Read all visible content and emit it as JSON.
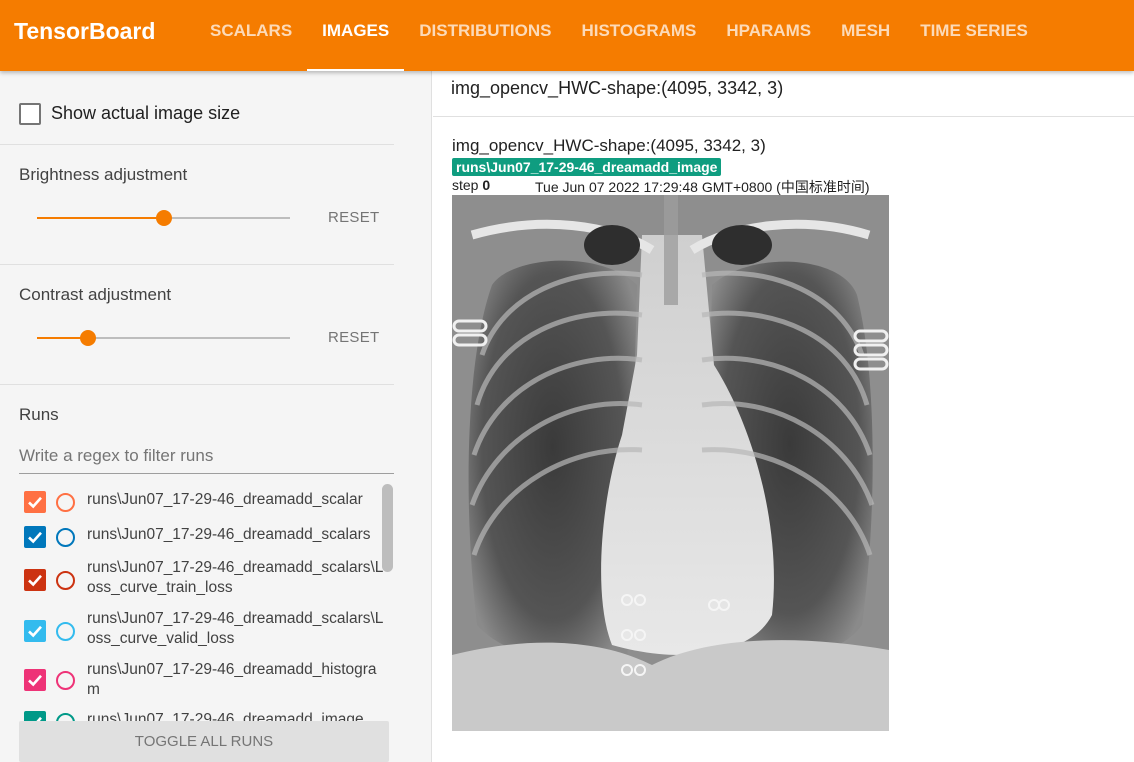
{
  "app": {
    "title": "TensorBoard"
  },
  "tabs": [
    {
      "label": "SCALARS",
      "active": false
    },
    {
      "label": "IMAGES",
      "active": true
    },
    {
      "label": "DISTRIBUTIONS",
      "active": false
    },
    {
      "label": "HISTOGRAMS",
      "active": false
    },
    {
      "label": "HPARAMS",
      "active": false
    },
    {
      "label": "MESH",
      "active": false
    },
    {
      "label": "TIME SERIES",
      "active": false
    }
  ],
  "sidebar": {
    "show_actual_size": {
      "label": "Show actual image size",
      "checked": false
    },
    "brightness": {
      "label": "Brightness adjustment",
      "value": 0.5,
      "reset": "RESET"
    },
    "contrast": {
      "label": "Contrast adjustment",
      "value": 0.2,
      "reset": "RESET"
    },
    "runs_title": "Runs",
    "filter_placeholder": "Write a regex to filter runs",
    "runs": [
      {
        "label": "runs\\Jun07_17-29-46_dreamadd_scalar",
        "color": "#ff7043",
        "checked": true
      },
      {
        "label": "runs\\Jun07_17-29-46_dreamadd_scalars",
        "color": "#0077bb",
        "checked": true
      },
      {
        "label": "runs\\Jun07_17-29-46_dreamadd_scalars\\Loss_curve_train_loss",
        "color": "#cc3311",
        "checked": true
      },
      {
        "label": "runs\\Jun07_17-29-46_dreamadd_scalars\\Loss_curve_valid_loss",
        "color": "#33bbee",
        "checked": true
      },
      {
        "label": "runs\\Jun07_17-29-46_dreamadd_histogram",
        "color": "#ee3377",
        "checked": true
      },
      {
        "label": "runs\\Jun07_17-29-46_dreamadd_image",
        "color": "#009988",
        "checked": true
      }
    ],
    "toggle_all": "TOGGLE ALL RUNS"
  },
  "main": {
    "tag": "img_opencv_HWC-shape:(4095, 3342, 3)",
    "card": {
      "title": "img_opencv_HWC-shape:(4095, 3342, 3)",
      "run": "runs\\Jun07_17-29-46_dreamadd_image",
      "step_label": "step",
      "step_value": "0",
      "timestamp": "Tue Jun 07 2022 17:29:48 GMT+0800 (中国标准时间)"
    }
  }
}
